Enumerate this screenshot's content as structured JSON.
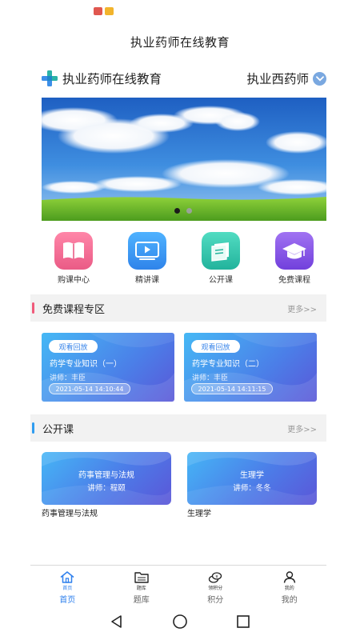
{
  "app_title": "执业药师在线教育",
  "brand": {
    "name": "执业药师在线教育",
    "category": "执业西药师"
  },
  "banner": {
    "slides": 2,
    "active_slide": 1
  },
  "quick_links": [
    {
      "label": "购课中心",
      "icon": "book-icon",
      "color": "#f06c95"
    },
    {
      "label": "精讲课",
      "icon": "play-icon",
      "color": "#3a9af0"
    },
    {
      "label": "公开课",
      "icon": "notebook-icon",
      "color": "#3ac6b0"
    },
    {
      "label": "免费课程",
      "icon": "graduation-cap-icon",
      "color": "#8a54e6"
    }
  ],
  "free_section": {
    "title": "免费课程专区",
    "more": "更多>>",
    "accent": "#f05a7a",
    "cards": [
      {
        "tag": "观看回放",
        "title": "药学专业知识（一）",
        "teacher": "讲师：丰臣",
        "time": "2021-05-14 14:10:44"
      },
      {
        "tag": "观看回放",
        "title": "药学专业知识（二）",
        "teacher": "讲师：丰臣",
        "time": "2021-05-14 14:11:15"
      }
    ]
  },
  "public_section": {
    "title": "公开课",
    "more": "更多>>",
    "accent": "#2f9cf0",
    "cards": [
      {
        "title": "药事管理与法规",
        "teacher": "讲师：程颐",
        "caption": "药事管理与法规"
      },
      {
        "title": "生理学",
        "teacher": "讲师：冬冬",
        "caption": "生理学"
      }
    ]
  },
  "tabs": [
    {
      "mini": "首页",
      "label": "首页",
      "icon": "home-icon",
      "active": true
    },
    {
      "mini": "题库",
      "label": "题库",
      "icon": "folder-icon",
      "active": false
    },
    {
      "mini": "领积分",
      "label": "积分",
      "icon": "coins-icon",
      "active": false
    },
    {
      "mini": "我的",
      "label": "我的",
      "icon": "person-icon",
      "active": false
    }
  ],
  "colors": {
    "tab_active": "#2f80ed",
    "card_gradient_start": "#46b8f5",
    "card_gradient_end": "#5a57d8"
  }
}
